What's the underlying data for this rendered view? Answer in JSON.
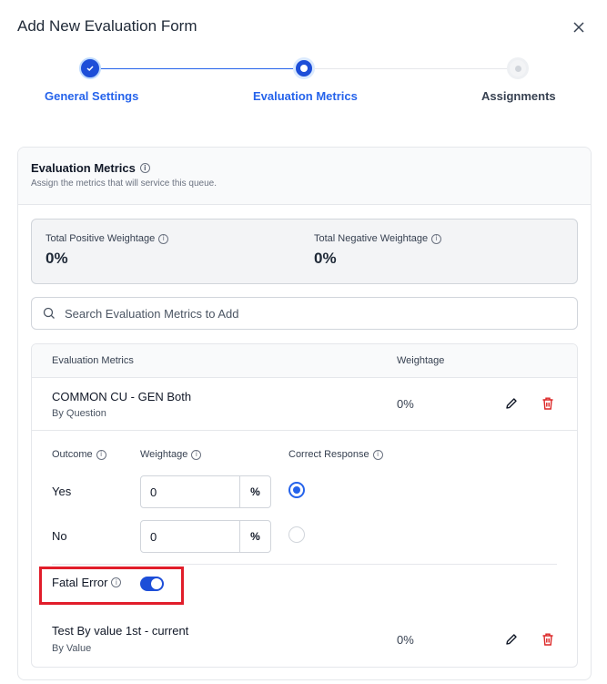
{
  "modal": {
    "title": "Add New Evaluation Form"
  },
  "stepper": {
    "steps": [
      {
        "label": "General Settings",
        "state": "completed"
      },
      {
        "label": "Evaluation Metrics",
        "state": "active"
      },
      {
        "label": "Assignments",
        "state": "pending"
      }
    ]
  },
  "section": {
    "title": "Evaluation Metrics",
    "subtitle": "Assign the metrics that will service this queue."
  },
  "weightage": {
    "positive_label": "Total Positive Weightage",
    "positive_value": "0%",
    "negative_label": "Total Negative Weightage",
    "negative_value": "0%"
  },
  "search": {
    "placeholder": "Search Evaluation Metrics to Add"
  },
  "table": {
    "headers": [
      "Evaluation Metrics",
      "Weightage"
    ],
    "rows": [
      {
        "name": "COMMON CU - GEN Both",
        "type": "By Question",
        "weightage": "0%"
      },
      {
        "name": "Test By value 1st - current",
        "type": "By Value",
        "weightage": "0%"
      }
    ]
  },
  "detail": {
    "outcome_label": "Outcome",
    "weightage_label": "Weightage",
    "correct_label": "Correct Response",
    "options": [
      {
        "name": "Yes",
        "value": "0",
        "suffix": "%",
        "correct": true
      },
      {
        "name": "No",
        "value": "0",
        "suffix": "%",
        "correct": false
      }
    ],
    "fatal_label": "Fatal Error",
    "fatal_enabled": true
  },
  "colors": {
    "accent": "#2563eb",
    "highlight": "#e11d2a",
    "delete": "#dc2626"
  }
}
